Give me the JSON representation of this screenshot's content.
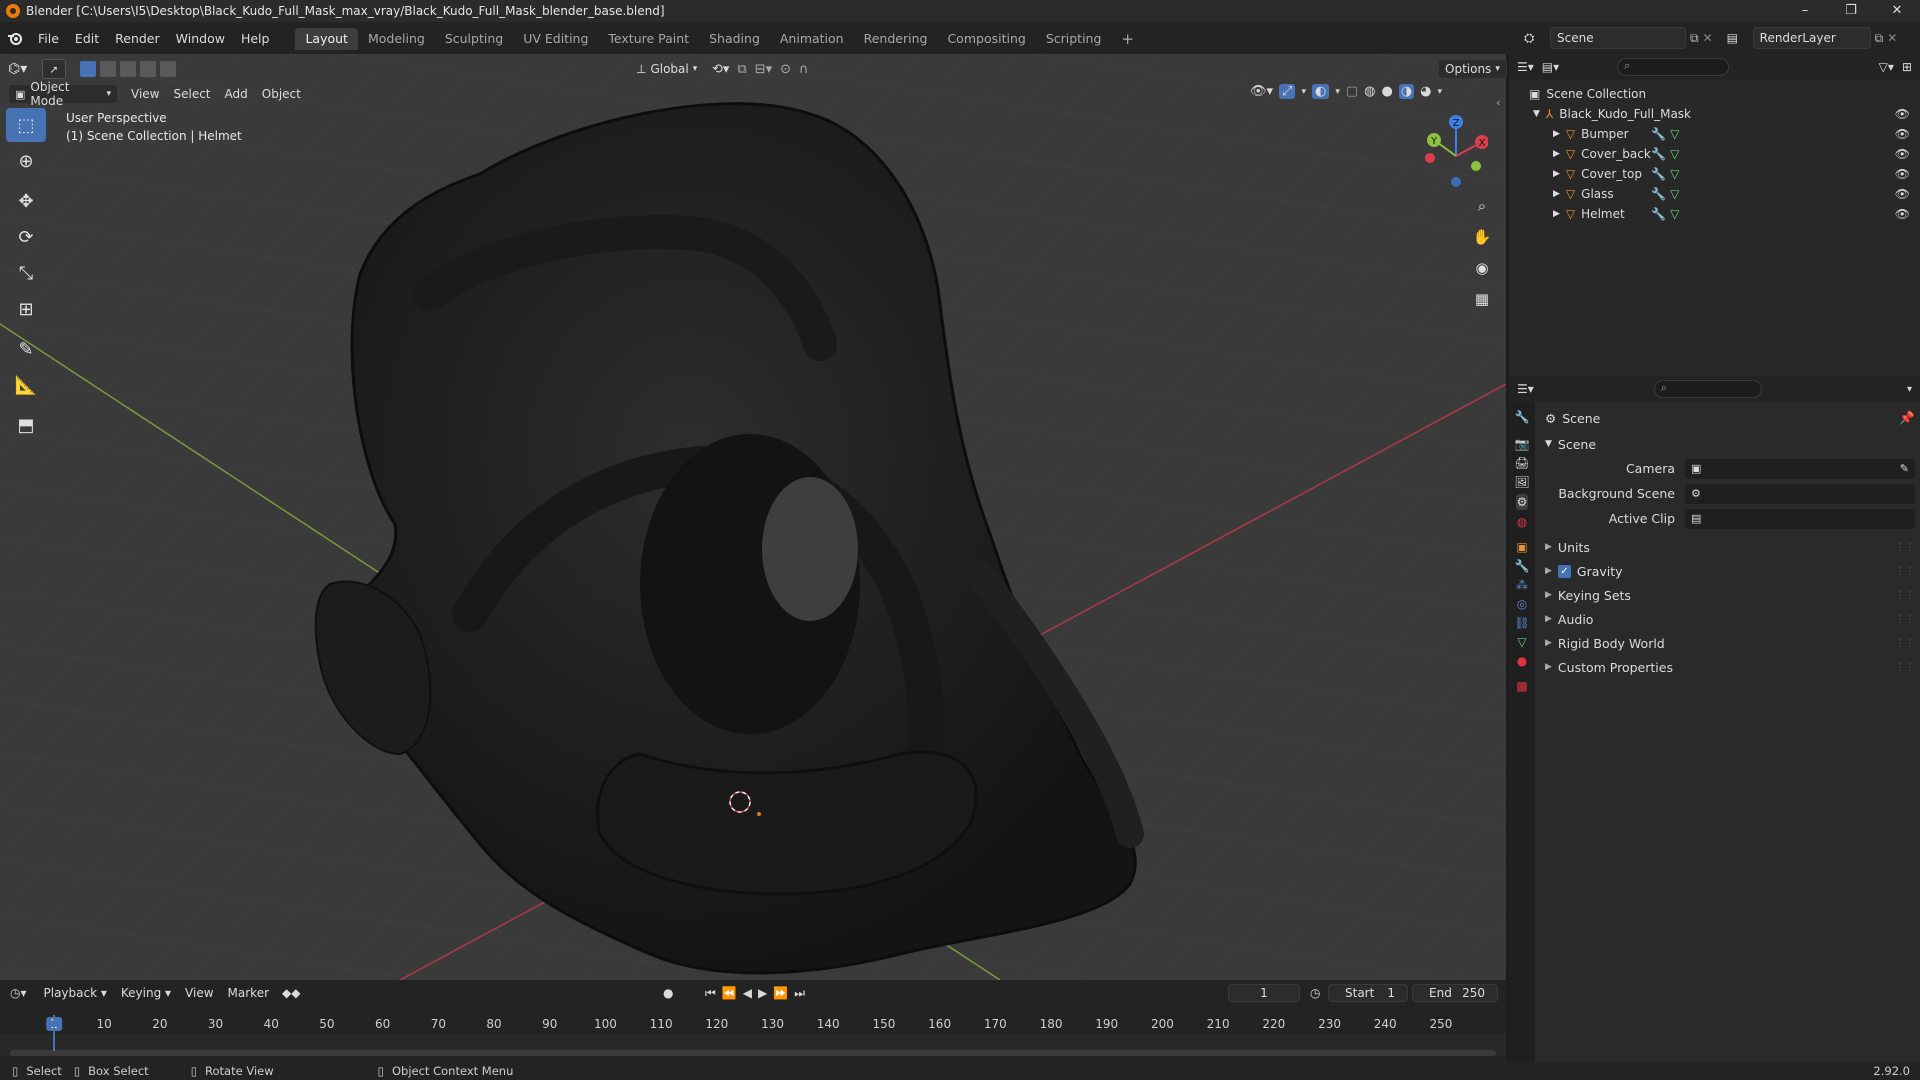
{
  "window": {
    "title": "Blender [C:\\Users\\I5\\Desktop\\Black_Kudo_Full_Mask_max_vray/Black_Kudo_Full_Mask_blender_base.blend]",
    "controls": [
      "–",
      "❐",
      "✕"
    ]
  },
  "menu": [
    "File",
    "Edit",
    "Render",
    "Window",
    "Help"
  ],
  "workspaces": [
    "Layout",
    "Modeling",
    "Sculpting",
    "UV Editing",
    "Texture Paint",
    "Shading",
    "Animation",
    "Rendering",
    "Compositing",
    "Scripting"
  ],
  "workspace_add": "+",
  "scene_selector": {
    "icon": "scene-icon",
    "value": "Scene"
  },
  "layer_selector": {
    "value": "RenderLayer"
  },
  "viewport_header": {
    "transform_orientation": "Global",
    "options_label": "Options",
    "mode": "Object Mode",
    "menus": [
      "View",
      "Select",
      "Add",
      "Object"
    ]
  },
  "viewport": {
    "perspective": "User Perspective",
    "collection_info": "(1) Scene Collection | Helmet",
    "gizmo": {
      "x": "X",
      "y": "Y",
      "z": "Z"
    }
  },
  "outliner": {
    "root": "Scene Collection",
    "parent": "Black_Kudo_Full_Mask",
    "objects": [
      "Bumper",
      "Cover_back",
      "Cover_top",
      "Glass",
      "Helmet"
    ]
  },
  "properties": {
    "header": "Scene",
    "panel": "Scene",
    "fields": [
      {
        "label": "Camera",
        "value": ""
      },
      {
        "label": "Background Scene",
        "value": ""
      },
      {
        "label": "Active Clip",
        "value": ""
      }
    ],
    "sections": [
      {
        "label": "Units",
        "checkbox": false
      },
      {
        "label": "Gravity",
        "checkbox": true
      },
      {
        "label": "Keying Sets",
        "checkbox": false
      },
      {
        "label": "Audio",
        "checkbox": false
      },
      {
        "label": "Rigid Body World",
        "checkbox": false
      },
      {
        "label": "Custom Properties",
        "checkbox": false
      }
    ]
  },
  "timeline": {
    "menus": [
      "Playback",
      "Keying",
      "View",
      "Marker"
    ],
    "current_frame": "1",
    "start_label": "Start",
    "start": "1",
    "end_label": "End",
    "end": "250",
    "ruler": [
      "1",
      "10",
      "20",
      "30",
      "40",
      "50",
      "60",
      "70",
      "80",
      "90",
      "100",
      "110",
      "120",
      "130",
      "140",
      "150",
      "160",
      "170",
      "180",
      "190",
      "200",
      "210",
      "220",
      "230",
      "240",
      "250"
    ]
  },
  "status": {
    "select": "Select",
    "box_select": "Box Select",
    "rotate_view": "Rotate View",
    "context_menu": "Object Context Menu",
    "version": "2.92.0"
  },
  "colors": {
    "accent": "#4772b3",
    "blender_orange": "#e87d0d",
    "x_axis": "#d93f4d",
    "y_axis": "#8fc23c",
    "z_axis": "#3b82e8"
  }
}
